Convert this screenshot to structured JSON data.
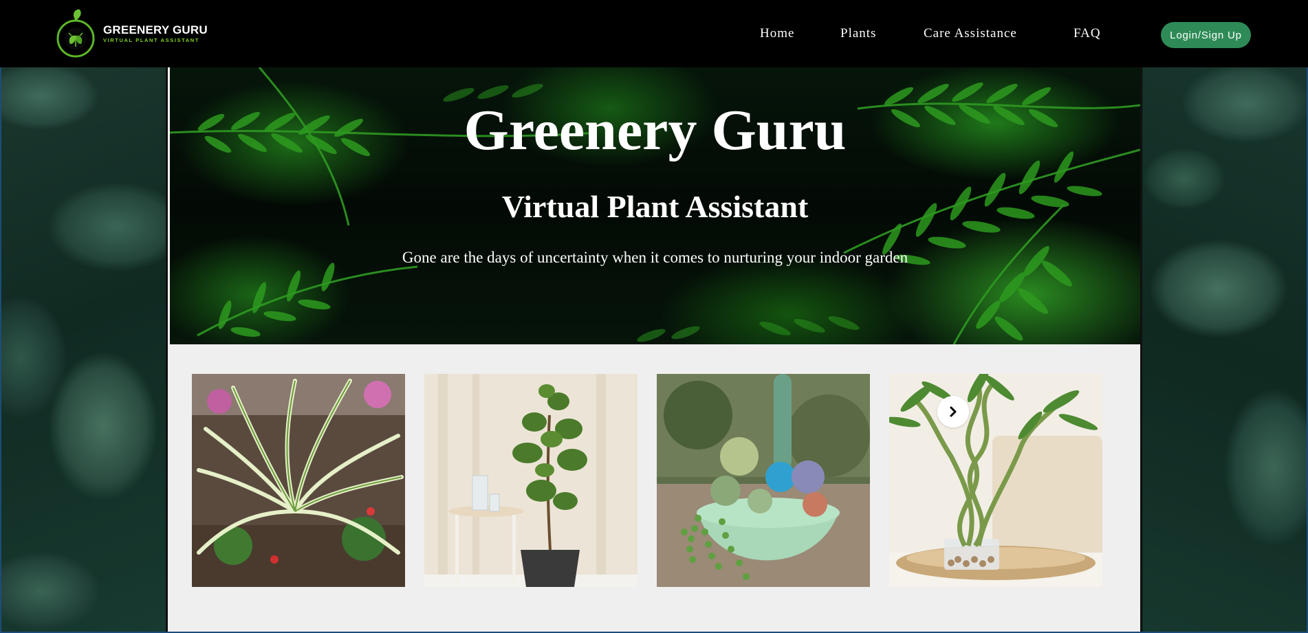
{
  "brand": {
    "name": "GREENERY GURU",
    "tagline": "VIRTUAL PLANT ASSISTANT",
    "accent_color": "#7ed321"
  },
  "nav": {
    "items": [
      {
        "label": "Home"
      },
      {
        "label": "Plants"
      },
      {
        "label": "Care Assistance"
      },
      {
        "label": "FAQ"
      }
    ],
    "login_label": "Login/Sign Up",
    "login_color": "#2e8b57"
  },
  "hero": {
    "title": "Greenery Guru",
    "subtitle": "Virtual Plant Assistant",
    "tagline": "Gone are the days of uncertainty when it comes to nurturing your indoor garden"
  },
  "carousel": {
    "cards": [
      {
        "image": "spider-plant"
      },
      {
        "image": "fiddle-leaf-fig"
      },
      {
        "image": "succulent-bowl"
      },
      {
        "image": "lucky-bamboo"
      }
    ],
    "next_icon": "chevron-right-icon"
  }
}
